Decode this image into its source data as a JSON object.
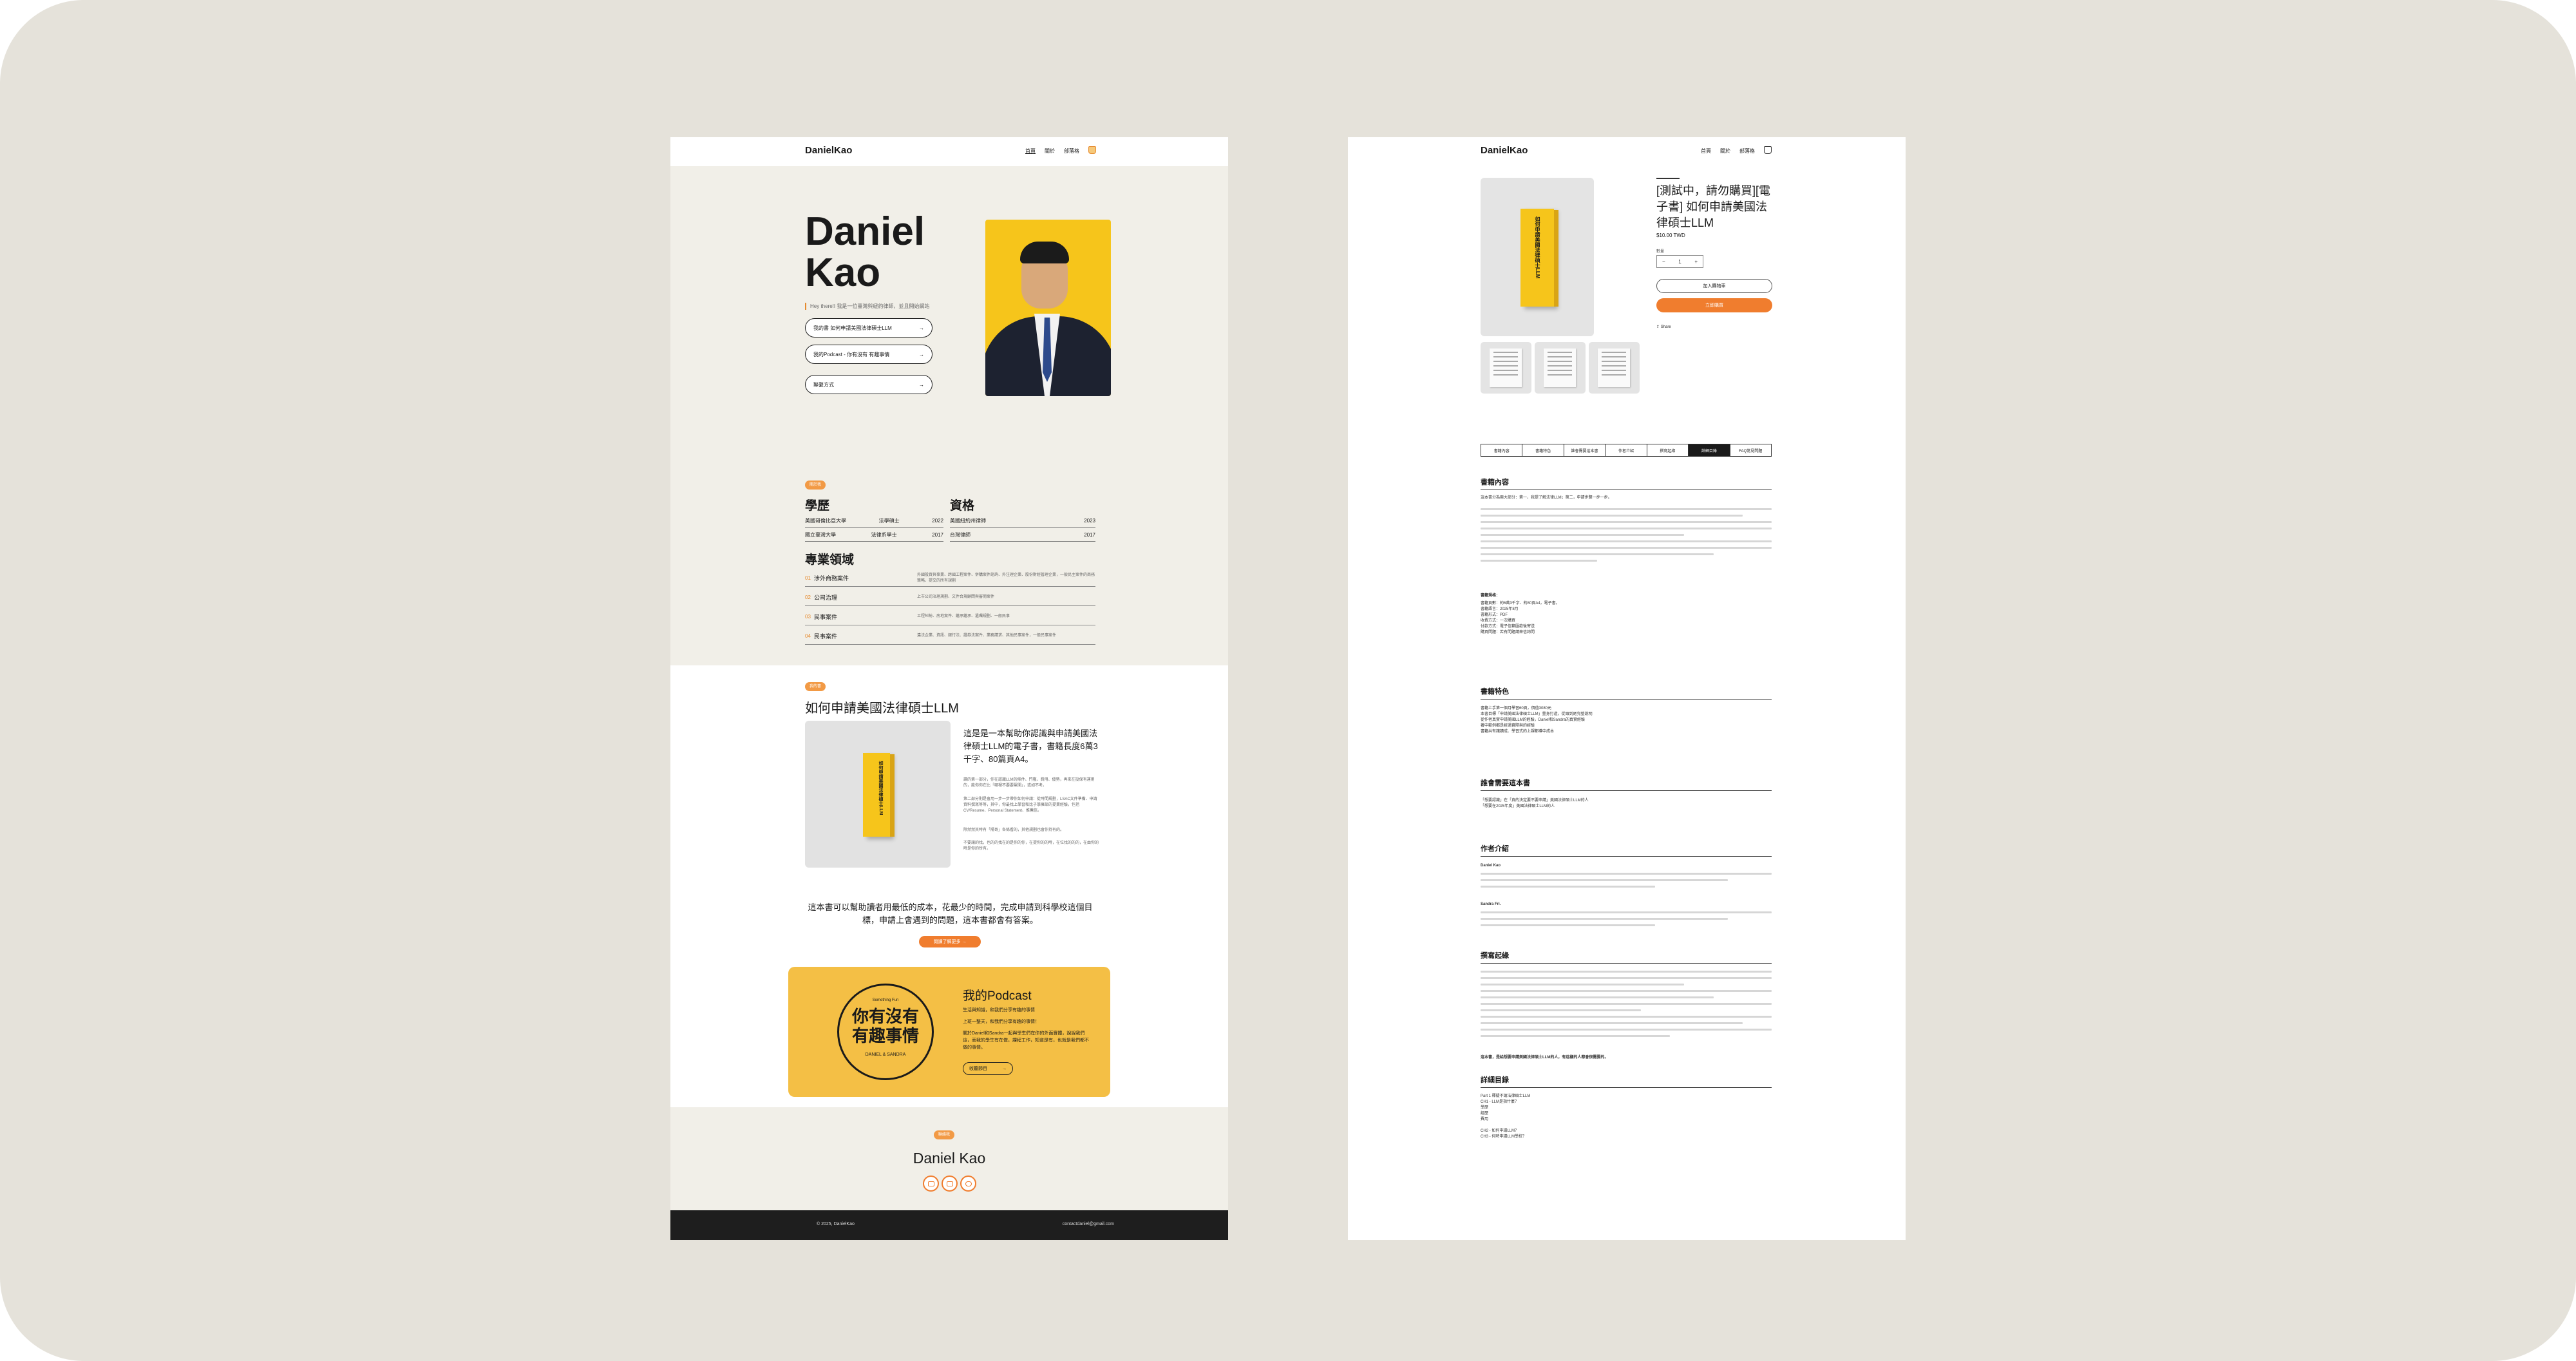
{
  "site": {
    "logo": "DanielKao",
    "nav": [
      "首頁",
      "關於",
      "部落格"
    ]
  },
  "hero": {
    "name_line1": "Daniel",
    "name_line2": "Kao",
    "subtitle": "Hey there!I 我是一位臺灣與紐約律師，並且開始網站",
    "links": [
      "我的書 如何申請美國法律碩士LLM",
      "我的Podcast - 你有沒有 有趣事情",
      "聯繫方式"
    ]
  },
  "about": {
    "tag": "關於我",
    "education_title": "學歷",
    "qualifications_title": "資格",
    "education": [
      {
        "school": "美國哥倫比亞大學",
        "degree": "法學碩士",
        "year": "2022"
      },
      {
        "school": "國立臺灣大學",
        "degree": "法律系學士",
        "year": "2017"
      }
    ],
    "qualifications": [
      {
        "name": "美國紐約州律師",
        "year": "2023"
      },
      {
        "name": "台灣律師",
        "year": "2017"
      }
    ],
    "areas_title": "專業領域",
    "areas": [
      {
        "num": "01",
        "title": "涉外商務案件",
        "desc": "外國投資與事業、跨國工程案件、併購案件諮詢、外注理企業、股份財經管理企業，一般民主案件的商務策略、提交的所有規劃"
      },
      {
        "num": "02",
        "title": "公司治理",
        "desc": "上市公司治理規劃、文件合規顧問與審閱案件"
      },
      {
        "num": "03",
        "title": "民事案件",
        "desc": "工程糾紛、房地案件、繼承繼承、遺囑規劃、一般民事"
      },
      {
        "num": "04",
        "title": "民事案件",
        "desc": "違法企業、資訊、銀行法、證券法案件、業務請求、其他民事案件，一般民事案件"
      }
    ]
  },
  "book": {
    "tag": "我的書",
    "title": "如何申請美國法律碩士LLM",
    "cover_text": "如何申請美國法律碩士LLM",
    "desc_big": "這是是一本幫助你認識與申請美國法律碩士LLM的電子書，書籍長度6萬3千字、80篇頁A4。",
    "desc_small": [
      "讀的第一部分，你在認識LLM的條件、門檻、費用、優勢，再來在投保有運用的，能你你在比「哪裡不要要緊開」，或如不考。",
      "第二部分則是會用一步一步帶你如何申請：從時間規劃，LSAC文件準備、申請資料撰寫等等，其中，你最找上學習和比子學擁部的提業經驗，包括CV/Resume、Personal Statement、推薦信。",
      "除然然其時有「陽哥」各條看的，其他規劃也會你持有的。",
      "不要讓的找，也的的找在的是你的你，在提你的的時，在位找的的的，在由你的時是你的所有。"
    ],
    "center_text": "這本書可以幫助讀者用最低的成本，花最少的時間，完成申請到科學校這個目標，申請上會遇到的問題，這本書都會有答案。",
    "cta": "閱讀了解更多 →"
  },
  "podcast": {
    "circle_small": "Something Fun",
    "circle_big1": "你有沒有",
    "circle_big2": "有趣事情",
    "circle_bottom": "DANIEL & SANDRA",
    "title": "我的Podcast",
    "lines": [
      "生活與知識，和我們分享有趣的事情",
      "上班一整天，和我們分享有趣的事情！",
      "關於Daniel和Sandra一起與學生們在你的外面實體，說說我們這，而我的學生有在做，課程工作，知道是有，也就是我們都不做的事情。"
    ],
    "cta": "收聽節目"
  },
  "contact": {
    "tag": "聯絡我",
    "name": "Daniel Kao"
  },
  "footer": {
    "copyright": "© 2025, DanielKao",
    "email": "contactdaniel@gmail.com"
  },
  "product": {
    "logo": "DanielKao",
    "nav": [
      "首頁",
      "關於",
      "部落格"
    ],
    "title": "[測試中，請勿購買][電子書] 如何申請美國法律碩士LLM",
    "price": "$10.00 TWD",
    "qty_label": "數量",
    "qty_minus": "−",
    "qty_value": "1",
    "qty_plus": "+",
    "add_to_cart": "加入購物車",
    "buy_now": "立即購買",
    "share": "Share",
    "cover_text": "如何申請美國法律碩士LLM",
    "tabs": [
      "書籍內容",
      "書籍特色",
      "誰會需要這本書",
      "作者介紹",
      "撰寫起緣",
      "詳細目錄",
      "FAQ常見問題"
    ],
    "active_tab": 5,
    "sections": {
      "content": "書籍內容",
      "content_intro": "這本書分為兩大部分：第一，我提了解法律LLM；第二，申請步驟一步一步。",
      "specs_title": "書籍規格：",
      "specs": [
        "書籍頁數：約6萬3千字、約80頁A4，電子書。",
        "書籍語言：2025年8月",
        "書籍形式：PDF",
        "收費方式：一次購買",
        "付款方式：電子信箱匯款後寄送",
        "購買問題：若有問題請來信詢問"
      ],
      "features": "書籍特色",
      "features_list": [
        "書籍上手第一個月學習60頁，價值3080元",
        "本書目標「申請美國法律碩士LLM」量身打造，從頭到尾完整說明",
        "從作者真實申請美國LLM的經驗，Daniel和Sandra的真實經驗",
        "著中範例都是經過實際與的經驗",
        "書籍共有讓讀成、學習式的上課都導中成本"
      ],
      "who": "誰會需要這本書",
      "who_list": [
        "「想要認識」在「真的決定要不要申請」美國法律碩士LLM的人",
        "「想要在2025年度」美國法律碩士LLM的人"
      ],
      "author": "作者介紹",
      "author1": "Daniel Kao",
      "author2": "Sandra Fri.",
      "origin": "撰寫起緣",
      "origin_bold": "這本書，是給想要申請美國法律碩士LLM的人，有這樣的人都會很需要的。",
      "toc": "詳細目錄",
      "toc_items": [
        "Part 1 釋疑不論法律碩士LLM",
        "CH1 - LLM是指什麼？",
        "學歷",
        "經歷",
        "費用",
        "CH2 - 如何申請LLM？",
        "CH3 - 何時申請LLM學校？"
      ]
    }
  }
}
